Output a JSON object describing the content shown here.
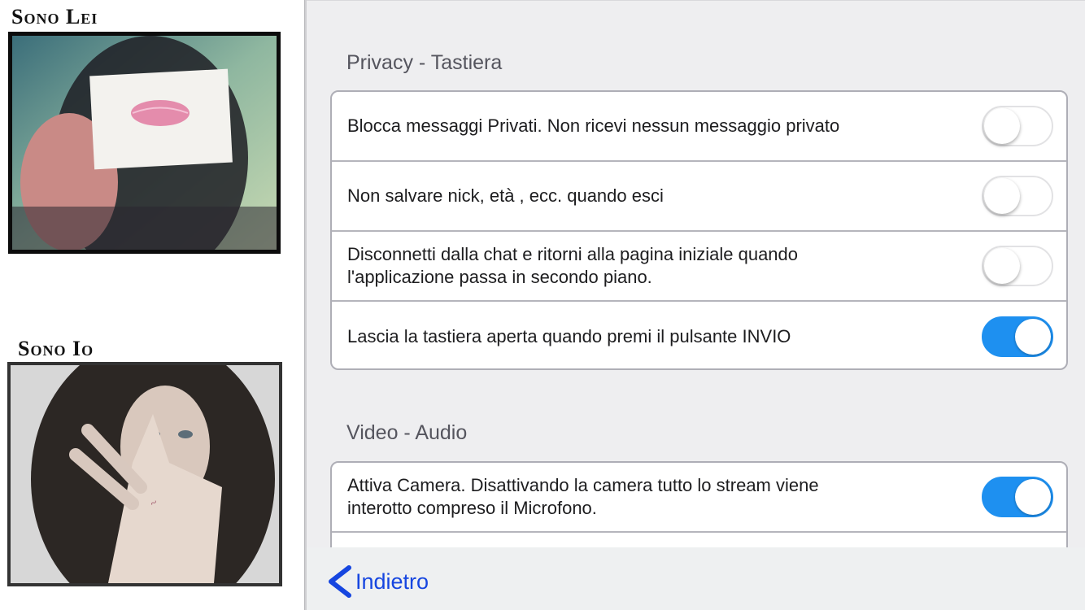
{
  "videos": {
    "partner_label": "Sono Lei",
    "self_label": "Sono Io"
  },
  "settings": {
    "sections": [
      {
        "title": "Privacy - Tastiera",
        "rows": [
          {
            "label": "Blocca messaggi Privati. Non ricevi nessun messaggio privato",
            "enabled": false
          },
          {
            "label": "Non salvare nick, età , ecc. quando esci",
            "enabled": false
          },
          {
            "label": "Disconnetti dalla chat e ritorni alla pagina iniziale quando l'applicazione passa in secondo piano.",
            "enabled": false
          },
          {
            "label": "Lascia la tastiera aperta quando premi il pulsante INVIO",
            "enabled": true
          }
        ]
      },
      {
        "title": "Video - Audio",
        "rows": [
          {
            "label": "Attiva Camera. Disattivando la camera tutto lo stream viene interotto compreso il Microfono.",
            "enabled": true
          },
          {
            "label": "",
            "enabled": false
          }
        ]
      }
    ]
  },
  "navigation": {
    "back_label": "Indietro",
    "back_icon": "chevron-left-icon"
  },
  "colors": {
    "accent": "#1e90f0",
    "link": "#1646e0",
    "panel_bg": "#eeeef0"
  }
}
